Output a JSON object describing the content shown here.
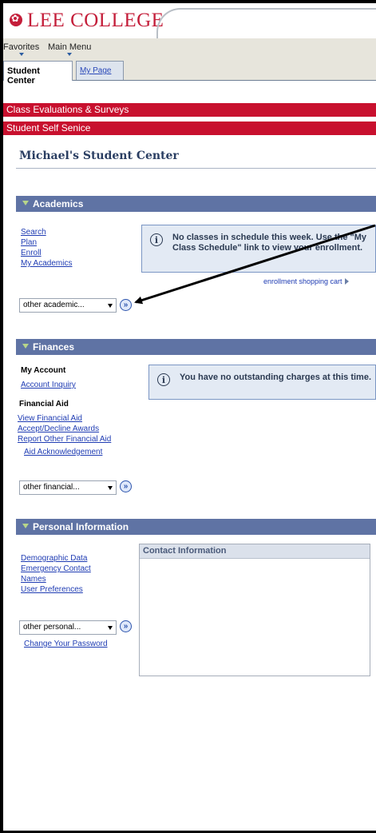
{
  "header": {
    "logo_text": "LEE COLLEGE"
  },
  "menu": {
    "items": [
      "Favorites",
      "Main Menu"
    ]
  },
  "tabs": {
    "active": "Student Center",
    "inactive": "My Page"
  },
  "banners": {
    "evaluations": "Class Evaluations & Surveys",
    "self_service": "Student Self Senice"
  },
  "page_title": "Michael's Student Center",
  "academics": {
    "header": "Academics",
    "links": [
      "Search",
      "Plan",
      "Enroll",
      "My Academics"
    ],
    "info_text": "No classes in schedule this week. Use the \"My Class Schedule\" link to view your enrollment.",
    "cart_link": "enrollment shopping cart",
    "select_value": "other academic..."
  },
  "finances": {
    "header": "Finances",
    "my_account_label": "My Account",
    "account_inquiry": "Account Inquiry",
    "financial_aid_label": "Financial Aid",
    "aid_links": [
      "View Financial Aid",
      "Accept/Decline Awards",
      "Report Other Financial Aid",
      "Aid Acknowledgement"
    ],
    "info_text": "You have no outstanding charges at this time.",
    "select_value": "other financial..."
  },
  "personal": {
    "header": "Personal Information",
    "links": [
      "Demographic Data",
      "Emergency Contact",
      "Names",
      "User Preferences"
    ],
    "select_value": "other personal...",
    "change_password": "Change Your Password",
    "contact_header": "Contact Information"
  },
  "colors": {
    "red_banner": "#c8102e",
    "section_header": "#5f73a4",
    "link": "#1f3cb3"
  }
}
